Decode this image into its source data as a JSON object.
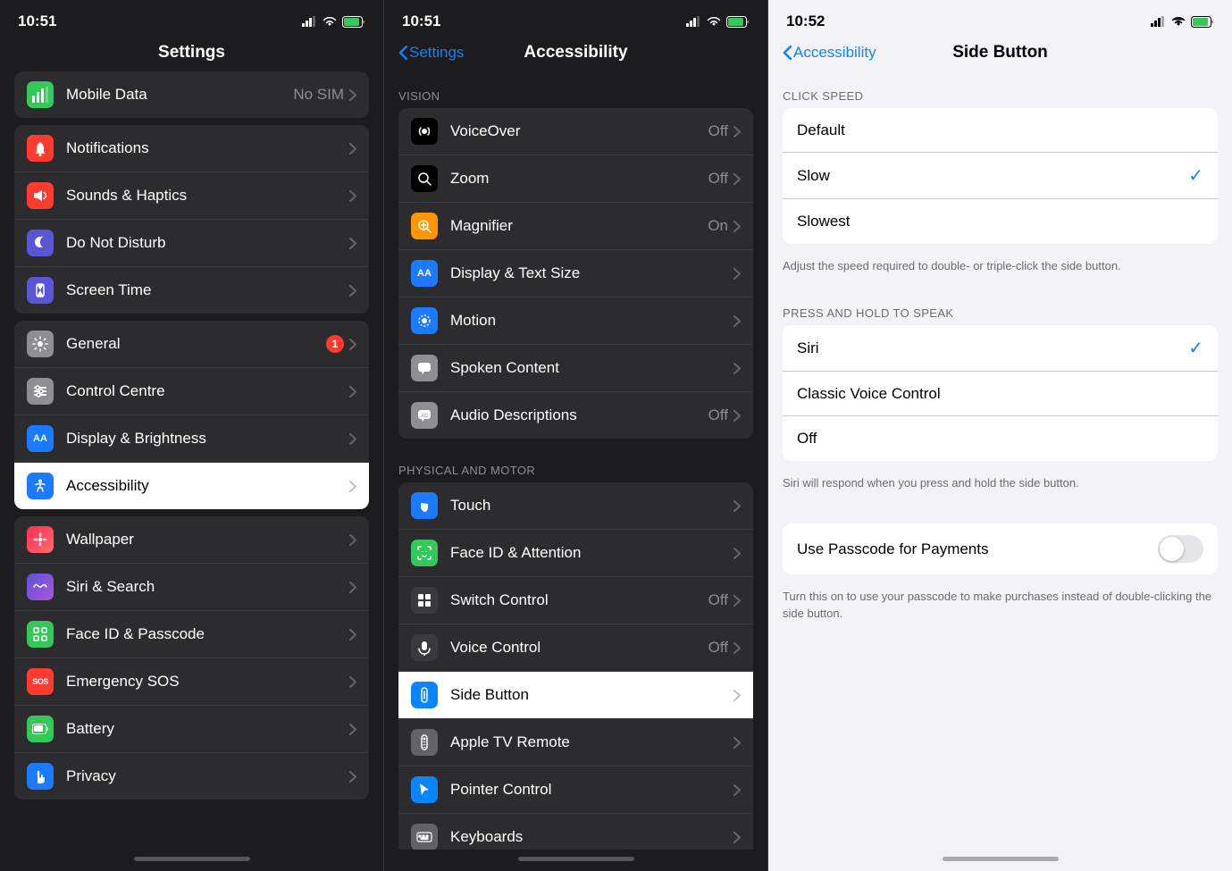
{
  "panel1": {
    "statusBar": {
      "time": "10:51",
      "signal": "●●●●●",
      "wifi": true,
      "battery": true
    },
    "navTitle": "Settings",
    "rows": [
      {
        "id": "mobile-data",
        "icon": "📶",
        "iconBg": "#34c759",
        "title": "Mobile Data",
        "value": "No SIM",
        "hasChevron": true
      },
      {
        "id": "notifications",
        "icon": "🔔",
        "iconBg": "#ff3b30",
        "title": "Notifications",
        "value": "",
        "hasChevron": true
      },
      {
        "id": "sounds",
        "icon": "🔊",
        "iconBg": "#ff3b30",
        "title": "Sounds & Haptics",
        "value": "",
        "hasChevron": true
      },
      {
        "id": "do-not-disturb",
        "icon": "🌙",
        "iconBg": "#5856d6",
        "title": "Do Not Disturb",
        "value": "",
        "hasChevron": true
      },
      {
        "id": "screen-time",
        "icon": "⏱",
        "iconBg": "#5856d6",
        "title": "Screen Time",
        "value": "",
        "hasChevron": true
      },
      {
        "id": "general",
        "icon": "⚙️",
        "iconBg": "#8e8e93",
        "title": "General",
        "value": "",
        "badge": "1",
        "hasChevron": true
      },
      {
        "id": "control-centre",
        "icon": "🎛",
        "iconBg": "#8e8e93",
        "title": "Control Centre",
        "value": "",
        "hasChevron": true
      },
      {
        "id": "display",
        "icon": "AA",
        "iconBg": "#1c7aff",
        "title": "Display & Brightness",
        "value": "",
        "hasChevron": true
      },
      {
        "id": "accessibility",
        "icon": "♿",
        "iconBg": "#1c7aff",
        "title": "Accessibility",
        "value": "",
        "hasChevron": true,
        "selected": true
      },
      {
        "id": "wallpaper",
        "icon": "🌸",
        "iconBg": "#ff2d55",
        "title": "Wallpaper",
        "value": "",
        "hasChevron": true
      },
      {
        "id": "siri",
        "icon": "🎵",
        "iconBg": "#5856d6",
        "title": "Siri & Search",
        "value": "",
        "hasChevron": true
      },
      {
        "id": "face-id",
        "icon": "👤",
        "iconBg": "#34c759",
        "title": "Face ID & Passcode",
        "value": "",
        "hasChevron": true
      },
      {
        "id": "sos",
        "icon": "SOS",
        "iconBg": "#ff3b30",
        "title": "Emergency SOS",
        "value": "",
        "hasChevron": true
      },
      {
        "id": "battery",
        "icon": "🔋",
        "iconBg": "#34c759",
        "title": "Battery",
        "value": "",
        "hasChevron": true
      },
      {
        "id": "privacy",
        "icon": "✋",
        "iconBg": "#1c7aff",
        "title": "Privacy",
        "value": "",
        "hasChevron": true
      }
    ]
  },
  "panel2": {
    "statusBar": {
      "time": "10:51"
    },
    "navBack": "Settings",
    "navTitle": "Accessibility",
    "sections": [
      {
        "header": "VISION",
        "rows": [
          {
            "id": "voiceover",
            "iconBg": "#000",
            "title": "VoiceOver",
            "value": "Off",
            "hasChevron": true
          },
          {
            "id": "zoom",
            "iconBg": "#000",
            "title": "Zoom",
            "value": "Off",
            "hasChevron": true
          },
          {
            "id": "magnifier",
            "iconBg": "#ff9500",
            "title": "Magnifier",
            "value": "On",
            "hasChevron": true
          },
          {
            "id": "display-text-size",
            "iconBg": "#1c7aff",
            "title": "Display & Text Size",
            "value": "",
            "hasChevron": true
          },
          {
            "id": "motion",
            "iconBg": "#1c7aff",
            "title": "Motion",
            "value": "",
            "hasChevron": true
          },
          {
            "id": "spoken-content",
            "iconBg": "#8e8e93",
            "title": "Spoken Content",
            "value": "",
            "hasChevron": true
          },
          {
            "id": "audio-desc",
            "iconBg": "#8e8e93",
            "title": "Audio Descriptions",
            "value": "Off",
            "hasChevron": true
          }
        ]
      },
      {
        "header": "PHYSICAL AND MOTOR",
        "rows": [
          {
            "id": "touch",
            "iconBg": "#1c7aff",
            "title": "Touch",
            "value": "",
            "hasChevron": true
          },
          {
            "id": "face-id-att",
            "iconBg": "#34c759",
            "title": "Face ID & Attention",
            "value": "",
            "hasChevron": true
          },
          {
            "id": "switch-control",
            "iconBg": "#2c2c2e",
            "title": "Switch Control",
            "value": "Off",
            "hasChevron": true
          },
          {
            "id": "voice-control",
            "iconBg": "#2c2c2e",
            "title": "Voice Control",
            "value": "Off",
            "hasChevron": true
          },
          {
            "id": "side-button",
            "iconBg": "#0a84ff",
            "title": "Side Button",
            "value": "",
            "hasChevron": true,
            "selected": true
          },
          {
            "id": "apple-tv",
            "iconBg": "#636366",
            "title": "Apple TV Remote",
            "value": "",
            "hasChevron": true
          },
          {
            "id": "pointer-control",
            "iconBg": "#0a84ff",
            "title": "Pointer Control",
            "value": "",
            "hasChevron": true
          },
          {
            "id": "keyboards",
            "iconBg": "#636366",
            "title": "Keyboards",
            "value": "",
            "hasChevron": true
          }
        ]
      }
    ]
  },
  "panel3": {
    "statusBar": {
      "time": "10:52"
    },
    "navBack": "Accessibility",
    "navTitle": "Side Button",
    "sections": [
      {
        "header": "CLICK SPEED",
        "rows": [
          {
            "id": "default",
            "title": "Default",
            "checked": false
          },
          {
            "id": "slow",
            "title": "Slow",
            "checked": true
          },
          {
            "id": "slowest",
            "title": "Slowest",
            "checked": false
          }
        ],
        "description": "Adjust the speed required to double- or triple-click the side button."
      },
      {
        "header": "PRESS AND HOLD TO SPEAK",
        "rows": [
          {
            "id": "siri",
            "title": "Siri",
            "checked": true
          },
          {
            "id": "classic-voice",
            "title": "Classic Voice Control",
            "checked": false
          },
          {
            "id": "off",
            "title": "Off",
            "checked": false
          }
        ],
        "description": "Siri will respond when you press and hold the side button."
      },
      {
        "header": "",
        "rows": [
          {
            "id": "use-passcode",
            "title": "Use Passcode for Payments",
            "hasToggle": true
          }
        ],
        "description": "Turn this on to use your passcode to make purchases instead of double-clicking the side button."
      }
    ]
  }
}
